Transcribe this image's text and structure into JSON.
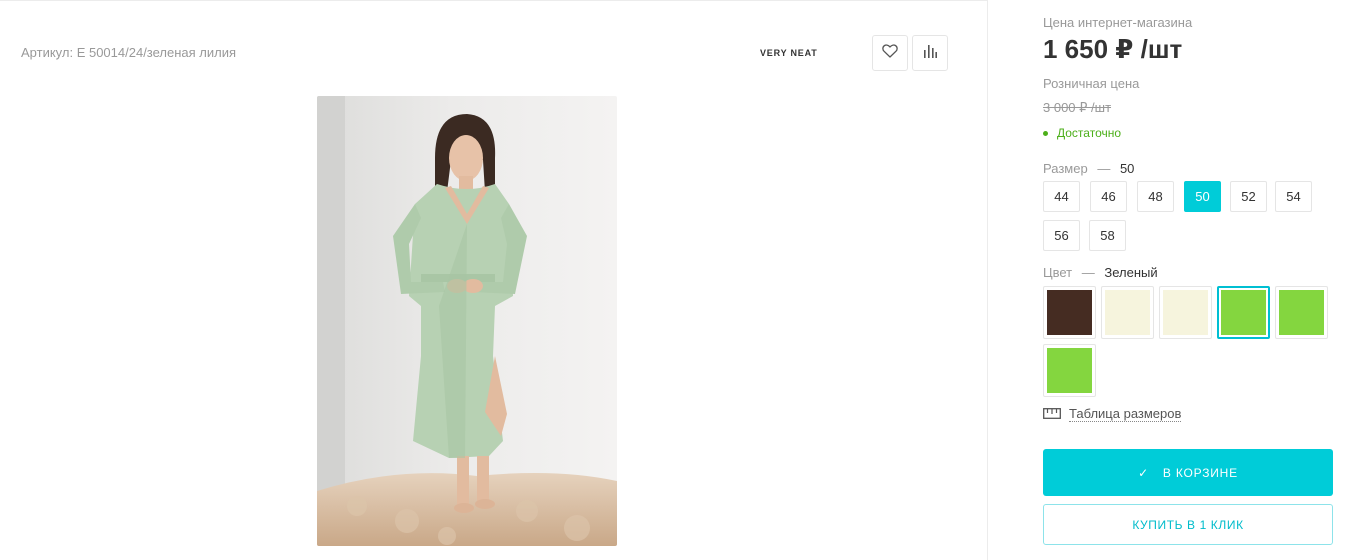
{
  "product": {
    "article": "Артикул: Е 50014/24/зеленая лилия",
    "brand": "VERY NEAT",
    "favorite_icon": "heart-icon",
    "compare_icon": "bar-chart-icon"
  },
  "pricing": {
    "online_label": "Цена интернет-магазина",
    "online_price": "1 650 ₽ /шт",
    "retail_label": "Розничная цена",
    "retail_price": "3 000 ₽ /шт",
    "stock_status": "Достаточно",
    "stock_color": "#4caf1a"
  },
  "size": {
    "label": "Размер",
    "dash": "—",
    "selected": "50",
    "options": [
      "44",
      "46",
      "48",
      "50",
      "52",
      "54",
      "56",
      "58"
    ]
  },
  "color": {
    "label": "Цвет",
    "dash": "—",
    "selected": "Зеленый",
    "swatches": [
      "#452c22",
      "#f6f4dd",
      "#f6f4dd",
      "#84d63f",
      "#84d63f",
      "#84d63f"
    ],
    "selected_index": 3
  },
  "size_table": {
    "icon": "ruler-icon",
    "label": "Таблица размеров"
  },
  "actions": {
    "in_cart": "В КОРЗИНЕ",
    "buy_one_click": "КУПИТЬ В 1 КЛИК",
    "accent": "#00ccd8"
  }
}
